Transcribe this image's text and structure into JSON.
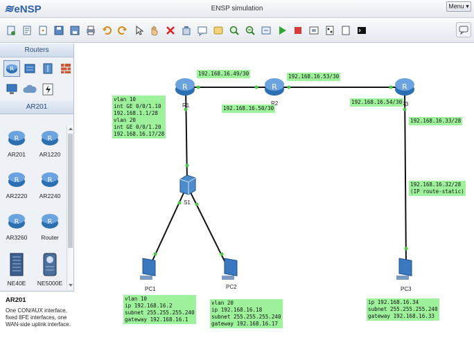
{
  "app": {
    "logo_text": "eNSP",
    "title": "ENSP simulation",
    "menu_label": "Menu"
  },
  "toolbar": {
    "buttons": [
      "new-topology",
      "new-example",
      "open",
      "save",
      "save-as",
      "print",
      "undo",
      "redo",
      "select",
      "pan",
      "delete",
      "delete-all",
      "text",
      "rectangle",
      "zoom-in",
      "zoom-out",
      "fit",
      "start",
      "stop",
      "capture",
      "topology",
      "panel",
      "console"
    ]
  },
  "left_panel": {
    "category_header": "Routers",
    "device_header": "AR201",
    "devices": [
      "AR201",
      "AR1220",
      "AR2220",
      "AR2240",
      "AR3260",
      "Router",
      "NE40E",
      "NE5000E"
    ],
    "description_title": "AR201",
    "description_text": "One CON/AUX interface, fixed 8FE interfaces, one WAN-side uplink interface."
  },
  "topology": {
    "nodes": {
      "r1": "R1",
      "r2": "R2",
      "r3": "R3",
      "s1": "S1",
      "pc1": "PC1",
      "pc2": "PC2",
      "pc3": "PC3"
    },
    "labels": {
      "r1_r2_top": "192.168.16.49/30",
      "r2_r3_top": "192.168.16.53/30",
      "r1_r2_bottom": "192.168.16.50/30",
      "r3_left": "192.168.16.54/30",
      "r3_down": "192.168.16.33/28",
      "r3_route": "192.168.16.32/28\n(IP route-static)",
      "r1_config": "vlan 10\nint GE 0/0/1.10\n192.168.1.1/28\nvlan 20\nint GE 0/0/1.20\n192.168.16.17/28",
      "pc1_config": "vlan 10\nip 192.168.16.2\nsubnet 255.255.255.240\ngateway 192.168.16.1",
      "pc2_config": "vlan 20\nip 192.168.16.18\nsubnet 255.255.255.240\ngateway 192.168.16.17",
      "pc3_config": "ip 192.168.16.34\nsubnet 255.255.255.240\ngateway 192.168.16.33"
    }
  },
  "colors": {
    "label_bg": "#9ef29c",
    "link": "#111111",
    "port_dot": "#44cc44",
    "router_blue": "#2d6fb3"
  }
}
